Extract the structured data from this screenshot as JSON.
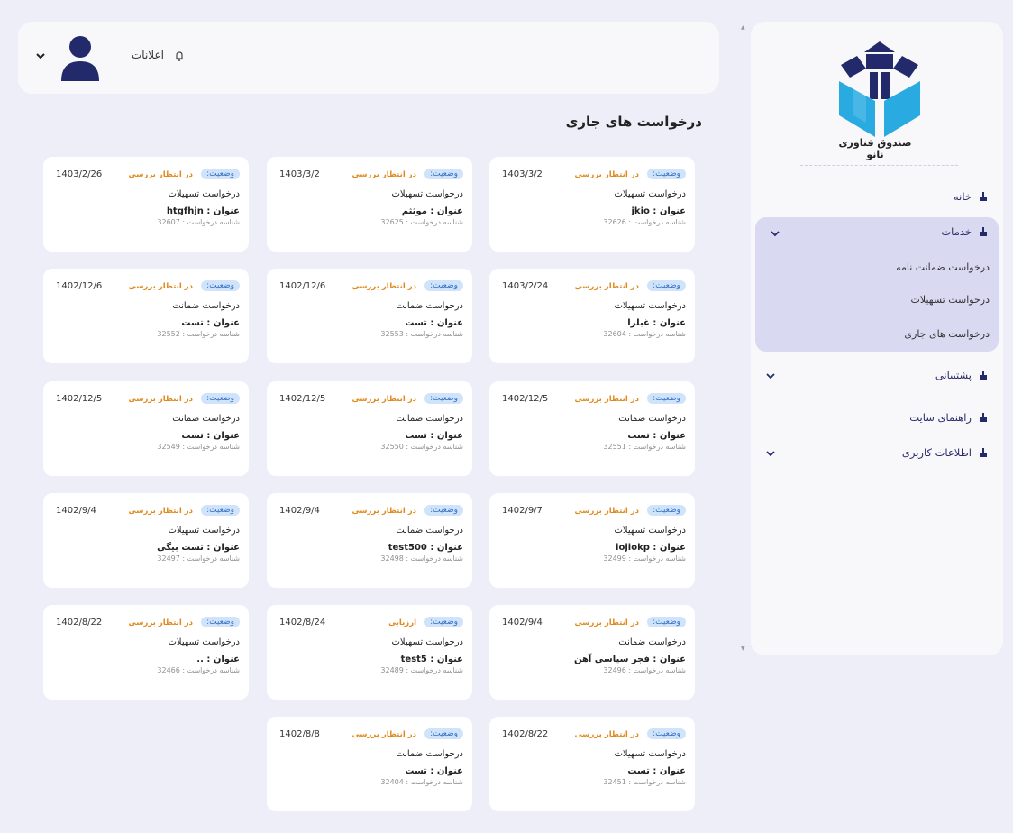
{
  "header": {
    "notifications_label": "اعلانات"
  },
  "page_title": "درخواست های جاری",
  "cards": [
    {
      "status_label": "وضعیت:",
      "status": "در انتظار بررسی",
      "date": "1403/3/2",
      "type": "درخواست تسهیلات",
      "title": "عنوان : jkio",
      "request_id": "شناسه درخواست : 32626"
    },
    {
      "status_label": "وضعیت:",
      "status": "در انتظار بررسی",
      "date": "1403/3/2",
      "type": "درخواست تسهیلات",
      "title": "عنوان : موثثم",
      "request_id": "شناسه درخواست : 32625"
    },
    {
      "status_label": "وضعیت:",
      "status": "در انتظار بررسی",
      "date": "1403/2/26",
      "type": "درخواست تسهیلات",
      "title": "عنوان : htgfhjn",
      "request_id": "شناسه درخواست : 32607"
    },
    {
      "status_label": "وضعیت:",
      "status": "در انتظار بررسی",
      "date": "1403/2/24",
      "type": "درخواست تسهیلات",
      "title": "عنوان : غبلرا",
      "request_id": "شناسه درخواست : 32604"
    },
    {
      "status_label": "وضعیت:",
      "status": "در انتظار بررسی",
      "date": "1402/12/6",
      "type": "درخواست ضمانت",
      "title": "عنوان : تست",
      "request_id": "شناسه درخواست : 32553"
    },
    {
      "status_label": "وضعیت:",
      "status": "در انتظار بررسی",
      "date": "1402/12/6",
      "type": "درخواست ضمانت",
      "title": "عنوان : تست",
      "request_id": "شناسه درخواست : 32552"
    },
    {
      "status_label": "وضعیت:",
      "status": "در انتظار بررسی",
      "date": "1402/12/5",
      "type": "درخواست ضمانت",
      "title": "عنوان : تست",
      "request_id": "شناسه درخواست : 32551"
    },
    {
      "status_label": "وضعیت:",
      "status": "در انتظار بررسی",
      "date": "1402/12/5",
      "type": "درخواست ضمانت",
      "title": "عنوان : تست",
      "request_id": "شناسه درخواست : 32550"
    },
    {
      "status_label": "وضعیت:",
      "status": "در انتظار بررسی",
      "date": "1402/12/5",
      "type": "درخواست ضمانت",
      "title": "عنوان : تست",
      "request_id": "شناسه درخواست : 32549"
    },
    {
      "status_label": "وضعیت:",
      "status": "در انتظار بررسی",
      "date": "1402/9/7",
      "type": "درخواست تسهیلات",
      "title": "عنوان : iojiokp",
      "request_id": "شناسه درخواست : 32499"
    },
    {
      "status_label": "وضعیت:",
      "status": "در انتظار بررسی",
      "date": "1402/9/4",
      "type": "درخواست ضمانت",
      "title": "عنوان : test500",
      "request_id": "شناسه درخواست : 32498"
    },
    {
      "status_label": "وضعیت:",
      "status": "در انتظار بررسی",
      "date": "1402/9/4",
      "type": "درخواست تسهیلات",
      "title": "عنوان : تست بیگی",
      "request_id": "شناسه درخواست : 32497"
    },
    {
      "status_label": "وضعیت:",
      "status": "در انتظار بررسی",
      "date": "1402/9/4",
      "type": "درخواست ضمانت",
      "title": "عنوان : فجر سپاسی آهن",
      "request_id": "شناسه درخواست : 32496"
    },
    {
      "status_label": "وضعیت:",
      "status": "ارزیابی",
      "date": "1402/8/24",
      "type": "درخواست تسهیلات",
      "title": "عنوان : test5",
      "request_id": "شناسه درخواست : 32489"
    },
    {
      "status_label": "وضعیت:",
      "status": "در انتظار بررسی",
      "date": "1402/8/22",
      "type": "درخواست تسهیلات",
      "title": "عنوان : ..",
      "request_id": "شناسه درخواست : 32466"
    },
    {
      "status_label": "وضعیت:",
      "status": "در انتظار بررسی",
      "date": "1402/8/22",
      "type": "درخواست تسهیلات",
      "title": "عنوان : تست",
      "request_id": "شناسه درخواست : 32451"
    },
    {
      "status_label": "وضعیت:",
      "status": "در انتظار بررسی",
      "date": "1402/8/8",
      "type": "درخواست ضمانت",
      "title": "عنوان : تست",
      "request_id": "شناسه درخواست : 32404"
    }
  ],
  "sidebar": {
    "logo_text": "صندوق فناوری نانو",
    "items": [
      {
        "label": "خانه"
      },
      {
        "label": "خدمات"
      },
      {
        "label": "پشتیبانی"
      },
      {
        "label": "راهنمای سایت"
      },
      {
        "label": "اطلاعات کاربری"
      }
    ],
    "services_sub": [
      {
        "label": "درخواست ضمانت نامه"
      },
      {
        "label": "درخواست تسهیلات"
      },
      {
        "label": "درخواست های جاری"
      }
    ]
  },
  "colors": {
    "background": "#eeeef9",
    "card": "#ffffff",
    "status_pill": "#cfe3fa",
    "status_text": "#e08a1e",
    "nav_active": "#d9d9f1",
    "brand_navy": "#222a6b",
    "logo_blue": "#29abe2"
  }
}
